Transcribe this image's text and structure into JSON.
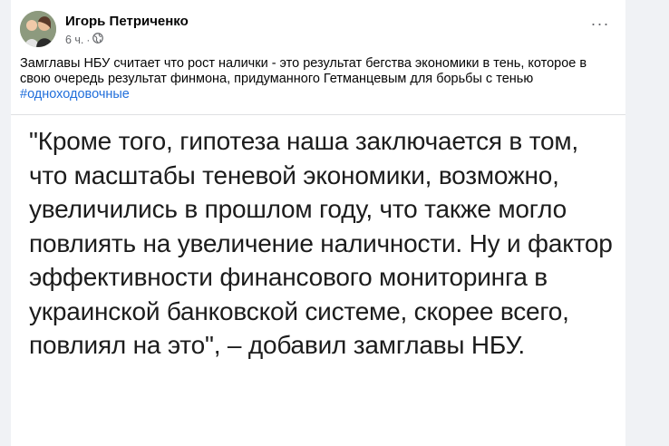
{
  "post": {
    "author": "Игорь Петриченко",
    "time": "6 ч.",
    "audience_icon": "globe-icon",
    "more_icon": "more-options-icon",
    "more_label": "···",
    "text": "Замглавы НБУ считает что рост налички - это результат бегства экономики  в тень, которое в свою очередь результат финмона,  придуманного Гетманцевым для борьбы с тенью",
    "hashtag": "#одноходовочные",
    "image_text": "\"Кроме того, гипотеза наша заключается в том, что масштабы теневой экономики, возможно, увеличились в прошлом году, что также могло повлиять на увеличение наличности. Ну и фактор эффективности финансового мониторинга в украинской банковской системе, скорее всего, повлиял на это\", – добавил замглавы НБУ."
  }
}
